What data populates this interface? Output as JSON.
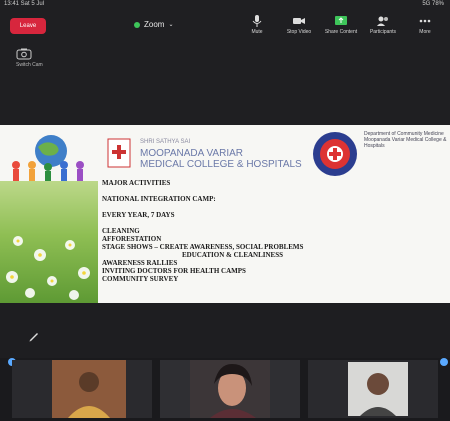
{
  "status_bar": {
    "time": "13:41 Sat 5 Jul",
    "right": "5G 78%"
  },
  "top_bar": {
    "end_label": "Leave",
    "zoom_label": "Zoom",
    "actions": [
      {
        "label": "Mute",
        "icon": "microphone-icon"
      },
      {
        "label": "Stop Video",
        "icon": "video-camera-icon"
      },
      {
        "label": "Share Content",
        "icon": "share-screen-icon"
      },
      {
        "label": "Participants",
        "icon": "participants-icon"
      },
      {
        "label": "More",
        "icon": "more-icon"
      }
    ]
  },
  "camera_switch": {
    "label": "Switch Cam",
    "icon": "camera-switch-icon"
  },
  "shared_slide": {
    "hospital": {
      "line1": "SHRI SATHYA SAI",
      "name": "MOOPANADA VARIAR",
      "name2": "MEDICAL COLLEGE & HOSPITALS"
    },
    "seal_text": "Department of Community Medicine Moopanada Variar Medical College & Hospitals",
    "activities": [
      "MAJOR ACTIVITIES",
      "",
      "NATIONAL INTEGRATION CAMP:",
      "",
      "EVERY YEAR, 7 DAYS",
      "",
      "CLEANING",
      "AFFORESTATION",
      "STAGE SHOWS – CREATE AWARENESS, SOCIAL PROBLEMS",
      "EDUCATION & CLEANLINESS",
      "AWARENESS RALLIES",
      "INVITING DOCTORS FOR HEALTH CAMPS",
      "COMMUNITY SURVEY"
    ]
  },
  "colors": {
    "end": "#d7263d",
    "accent": "#3ec55a",
    "handle": "#5aa9ff",
    "bg": "#1f1f22"
  }
}
